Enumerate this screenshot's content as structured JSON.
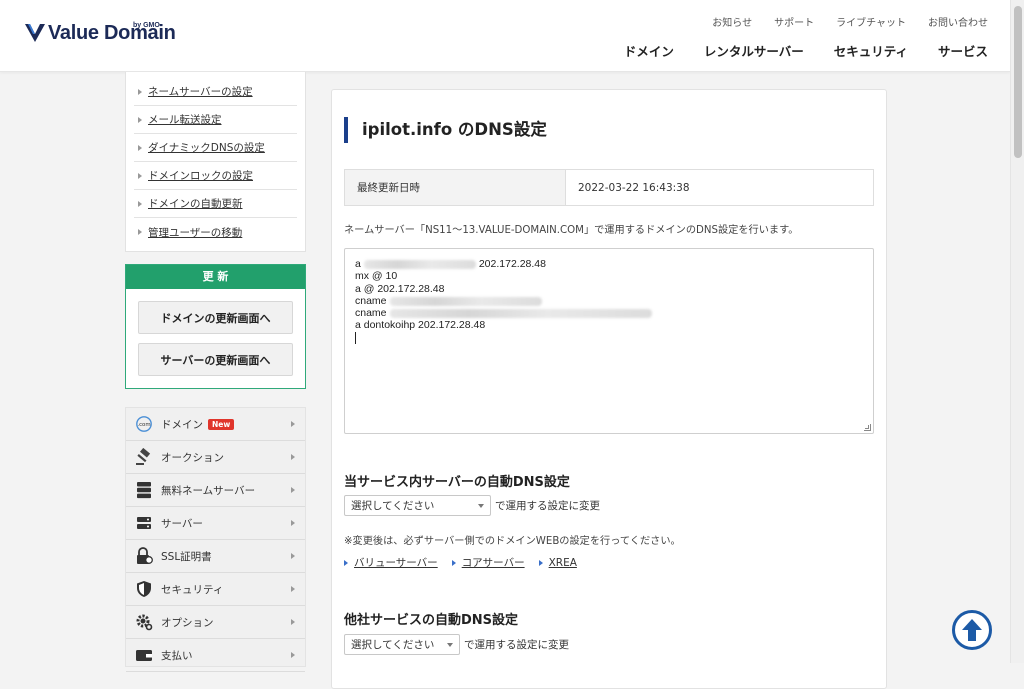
{
  "header": {
    "logo_text": "Value Domain",
    "logo_sub": "by GMO",
    "util_nav": [
      "お知らせ",
      "サポート",
      "ライブチャット",
      "お問い合わせ"
    ],
    "main_nav": [
      "ドメイン",
      "レンタルサーバー",
      "セキュリティ",
      "サービス"
    ]
  },
  "sidebar": {
    "sub_menu": [
      "ネームサーバーの設定",
      "メール転送設定",
      "ダイナミックDNSの設定",
      "ドメインロックの設定",
      "ドメインの自動更新",
      "管理ユーザーの移動"
    ],
    "renew": {
      "heading": "更 新",
      "domain_button": "ドメインの更新画面へ",
      "server_button": "サーバーの更新画面へ"
    },
    "categories": [
      {
        "label": "ドメイン",
        "icon": "dotcom-icon",
        "badge": "New"
      },
      {
        "label": "オークション",
        "icon": "gavel-icon"
      },
      {
        "label": "無料ネームサーバー",
        "icon": "server-stack-icon"
      },
      {
        "label": "サーバー",
        "icon": "server-icon"
      },
      {
        "label": "SSL証明書",
        "icon": "ssl-lock-icon"
      },
      {
        "label": "セキュリティ",
        "icon": "shield-icon"
      },
      {
        "label": "オプション",
        "icon": "gear-icon"
      },
      {
        "label": "支払い",
        "icon": "wallet-icon"
      }
    ]
  },
  "main": {
    "title": "ipilot.info のDNS設定",
    "last_updated_label": "最終更新日時",
    "last_updated_value": "2022-03-22 16:43:38",
    "description": "ネームサーバー「NS11～13.VALUE-DOMAIN.COM」で運用するドメインのDNS設定を行います。",
    "dns_records": {
      "line1_type": "a",
      "line1_value": "202.172.28.48",
      "line2": "mx @ 10",
      "line3": "a @ 202.172.28.48",
      "line4_type": "cname",
      "line5_type": "cname",
      "line6": "a dontokoihp 202.172.28.48"
    },
    "internal_dns": {
      "heading": "当サービス内サーバーの自動DNS設定",
      "select_value": "選択してください",
      "select_suffix": "で運用する設定に変更",
      "note": "※変更後は、必ずサーバー側でのドメインWEBの設定を行ってください。",
      "links": [
        "バリューサーバー",
        "コアサーバー",
        "XREA"
      ]
    },
    "external_dns": {
      "heading": "他社サービスの自動DNS設定",
      "select_value": "選択してください",
      "select_suffix": "で運用する設定に変更"
    }
  },
  "colors": {
    "brand_navy": "#1c2a57",
    "title_bar": "#1b3f8b",
    "renew_green": "#22a06c",
    "new_badge": "#e0352b",
    "to_top_blue": "#1c5aa6"
  }
}
